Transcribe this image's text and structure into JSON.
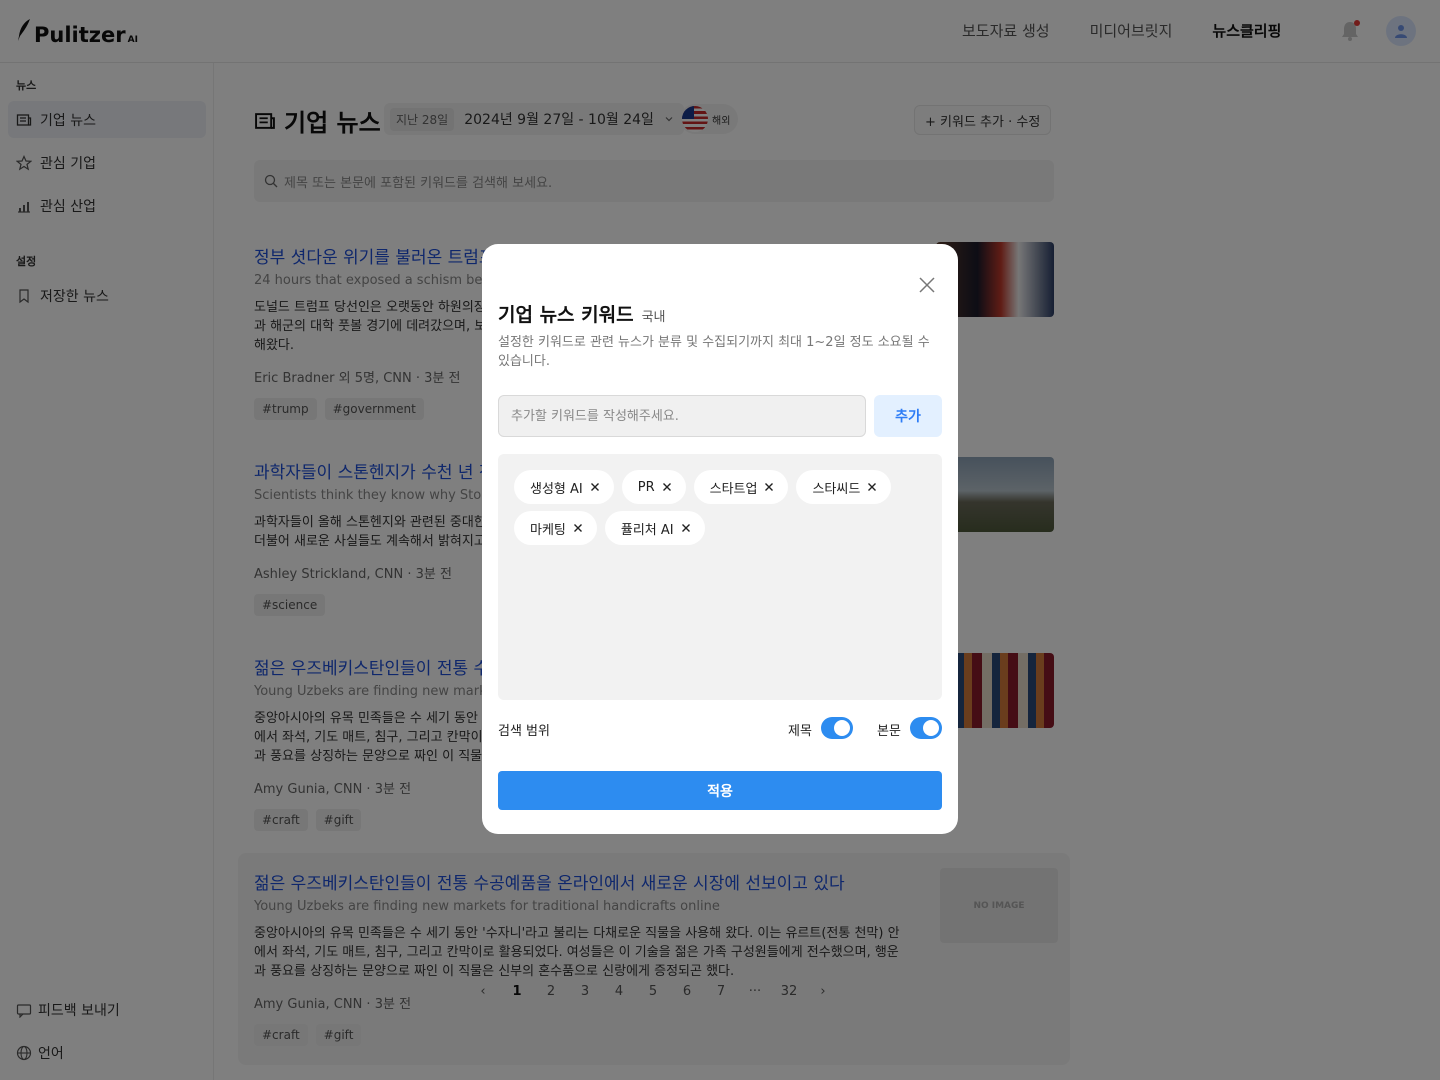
{
  "header": {
    "logo": "Pulitzer",
    "logo_suffix": "AI",
    "nav": [
      "보도자료 생성",
      "미디어브릿지",
      "뉴스클리핑"
    ]
  },
  "sidebar": {
    "section_news": "뉴스",
    "items": [
      "기업 뉴스",
      "관심 기업",
      "관심 산업"
    ],
    "section_settings": "설정",
    "saved": "저장한 뉴스",
    "feedback": "피드백 보내기",
    "language": "언어"
  },
  "main": {
    "title": "기업 뉴스",
    "days": "지난 28일",
    "date_range": "2024년 9월 27일 - 10월 24일",
    "region": "해외",
    "keyword_button": "+ 키워드 추가 · 수정",
    "search_placeholder": "제목 또는 본문에 포함된 키워드를 검색해 보세요."
  },
  "articles": [
    {
      "title": "정부 셧다운 위기를 불러온 트럼프",
      "subtitle": "24 hours that exposed a schism betw",
      "body": "도널드 트럼프 당선인은 오랫동안 하원의장\n과 해군의 대학 풋볼 경기에 데려갔으며, 보\n해왔다.",
      "meta": "Eric Bradner 외 5명, CNN · 3분 전",
      "tags": [
        "#trump",
        "#government"
      ]
    },
    {
      "title": "과학자들이 스톤헨지가 수천 년 전",
      "subtitle": "Scientists think they know why Stone",
      "body": "과학자들이 올해 스톤헨지와 관련된 중대한\n더불어 새로운 사실들도 계속해서 밝혀지고",
      "meta": "Ashley Strickland, CNN · 3분 전",
      "tags": [
        "#science"
      ]
    },
    {
      "title": "젊은 우즈베키스탄인들이 전통 수",
      "subtitle": "Young Uzbeks are finding new marke",
      "body": "중앙아시아의 유목 민족들은 수 세기 동안\n에서 좌석, 기도 매트, 침구, 그리고 칸막이\n과 풍요를 상징하는 문양으로 짜인 이 직물",
      "meta": "Amy Gunia, CNN · 3분 전",
      "tags": [
        "#craft",
        "#gift"
      ]
    },
    {
      "title": "젊은 우즈베키스탄인들이 전통 수공예품을 온라인에서 새로운 시장에 선보이고 있다",
      "subtitle": "Young Uzbeks are finding new markets for traditional handicrafts online",
      "body": "중앙아시아의 유목 민족들은 수 세기 동안 '수자니'라고 불리는 다채로운 직물을 사용해 왔다. 이는 유르트(전통 천막) 안에서 좌석, 기도 매트, 침구, 그리고 칸막이로 활용되었다. 여성들은 이 기술을 젊은 가족 구성원들에게 전수했으며, 행운과 풍요를 상징하는 문양으로 짜인 이 직물은 신부의 혼수품으로 신랑에게 증정되곤 했다.",
      "meta": "Amy Gunia, CNN · 3분 전",
      "tags": [
        "#craft",
        "#gift"
      ],
      "no_image": "NO IMAGE"
    }
  ],
  "pagination": {
    "prev": "‹",
    "pages": [
      "1",
      "2",
      "3",
      "4",
      "5",
      "6",
      "7",
      "···",
      "32"
    ],
    "next": "›",
    "current": "1"
  },
  "modal": {
    "title": "기업 뉴스 키워드",
    "subtitle": "국내",
    "description": "설정한 키워드로 관련 뉴스가 분류 및 수집되기까지 최대 1~2일 정도 소요될 수 있습니다.",
    "input_placeholder": "추가할 키워드를 작성해주세요.",
    "input_value": "",
    "add_label": "추가",
    "keywords": [
      "생성형 AI",
      "PR",
      "스타트업",
      "스타씨드",
      "마케팅",
      "퓰리처 AI"
    ],
    "search_range_label": "검색 범위",
    "toggle_title_label": "제목",
    "toggle_title_on": true,
    "toggle_body_label": "본문",
    "toggle_body_on": true,
    "apply_label": "적용"
  },
  "colors": {
    "accent": "#2d8cf0",
    "link": "#1e4fd8",
    "overlay": "rgba(0,0,0,0.5)"
  }
}
